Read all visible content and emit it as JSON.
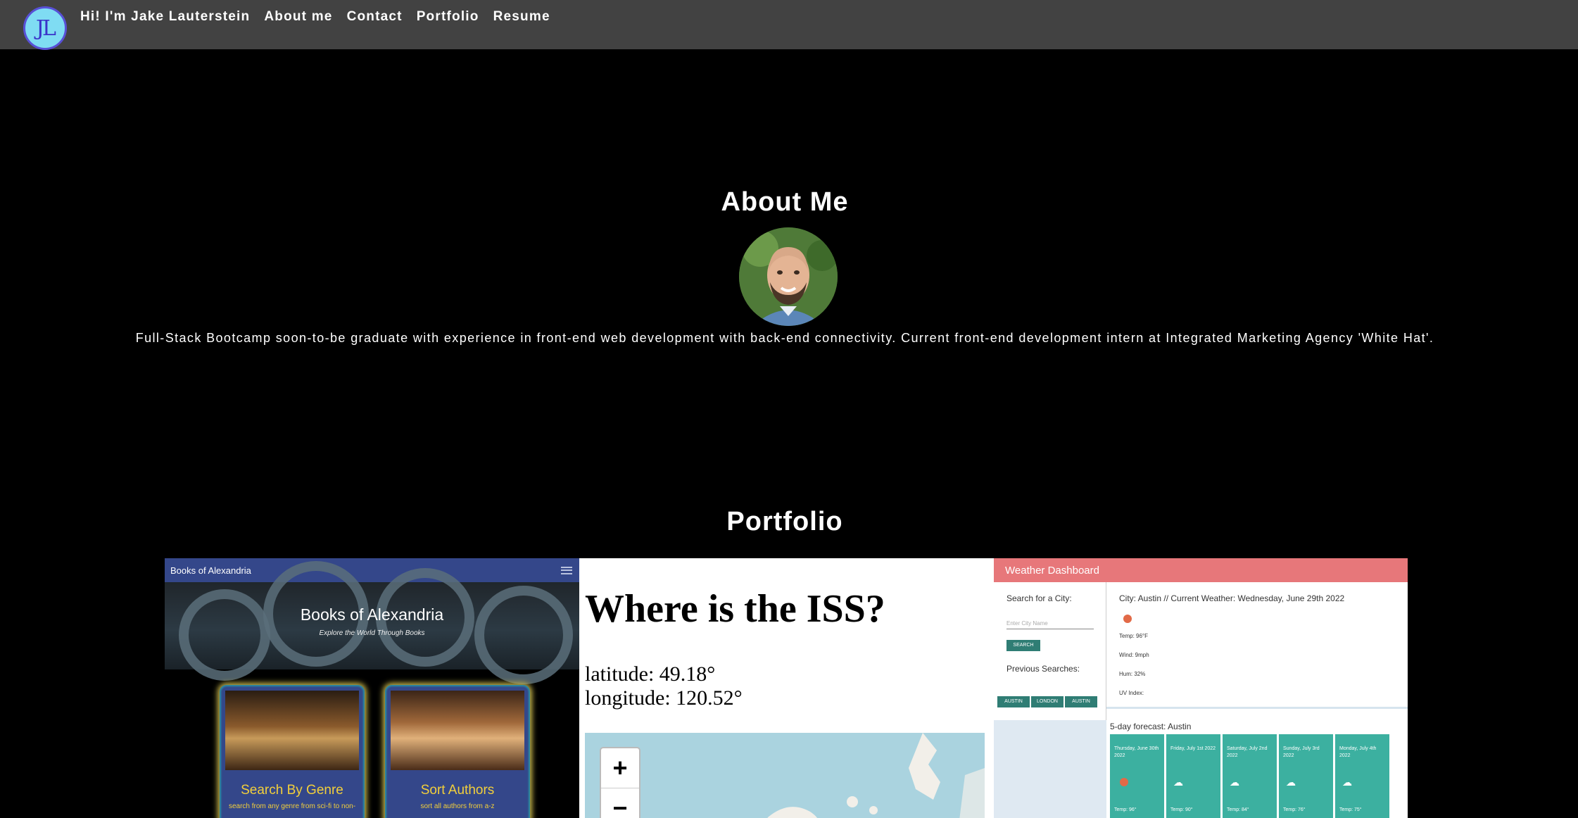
{
  "nav": {
    "logo_text": "JL",
    "links": [
      "Hi! I'm Jake Lauterstein",
      "About me",
      "Contact",
      "Portfolio",
      "Resume"
    ]
  },
  "about": {
    "title": "About Me",
    "bio": "Full-Stack Bootcamp soon-to-be graduate with experience in front-end web development with back-end connectivity. Current front-end development intern at Integrated Marketing Agency 'White Hat'."
  },
  "portfolio": {
    "title": "Portfolio",
    "books": {
      "app_name": "Books of Alexandria",
      "hero_title": "Books of Alexandria",
      "hero_tagline": "Explore the World Through Books",
      "tiles": [
        {
          "title": "Search By Genre",
          "desc": "search from any genre from sci-fi to non-"
        },
        {
          "title": "Sort Authors",
          "desc": "sort all authors from a-z"
        }
      ]
    },
    "iss": {
      "title": "Where is the ISS?",
      "latitude": "latitude: 49.18°",
      "longitude": "longitude: 120.52°",
      "zoom_in": "+",
      "zoom_out": "−"
    },
    "weather": {
      "title": "Weather Dashboard",
      "search_label": "Search for a City:",
      "input_placeholder": "Enter City Name",
      "search_button": "SEARCH",
      "previous_label": "Previous Searches:",
      "previous": [
        "AUSTIN",
        "LONDON",
        "AUSTIN"
      ],
      "current_heading": "City: Austin // Current Weather: Wednesday, June 29th 2022",
      "temp": "Temp: 96°F",
      "wind": "Wind: 9mph",
      "hum": "Hum: 32%",
      "uv": "UV Index:",
      "forecast_title": "5-day forecast: Austin",
      "forecast": [
        {
          "day": "Thursday, June 30th 2022",
          "temp": "Temp: 96°",
          "icon": "sun-icon"
        },
        {
          "day": "Friday, July 1st 2022",
          "temp": "Temp: 90°",
          "icon": "cloud-icon"
        },
        {
          "day": "Saturday, July 2nd 2022",
          "temp": "Temp: 84°",
          "icon": "cloud-icon"
        },
        {
          "day": "Sunday, July 3rd 2022",
          "temp": "Temp: 76°",
          "icon": "cloud-icon"
        },
        {
          "day": "Monday, July 4th 2022",
          "temp": "Temp: 75°",
          "icon": "cloud-icon"
        }
      ]
    }
  },
  "colors": {
    "nav_bg": "#424242",
    "page_bg": "#000000",
    "books_accent": "#34478a",
    "books_gold": "#f2cf3b",
    "weather_header": "#e7777a",
    "weather_teal": "#3cb0a0"
  }
}
